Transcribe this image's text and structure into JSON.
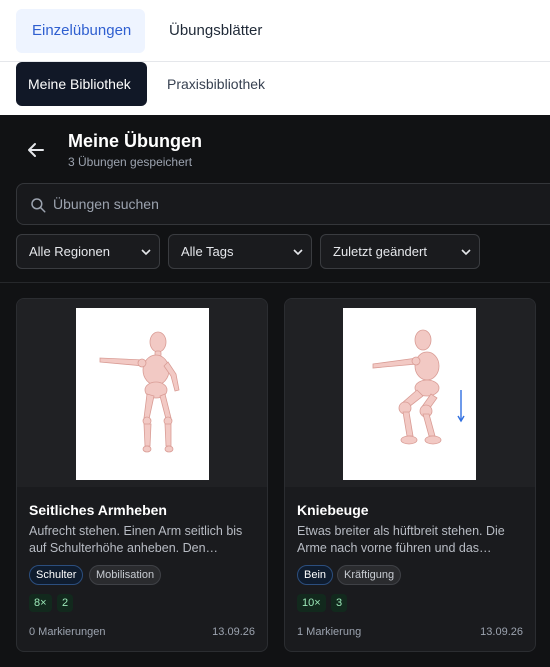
{
  "top_tabs": {
    "active": "Einzelübungen",
    "inactive": "Übungsblätter"
  },
  "sub_tabs": {
    "active": "Meine Bibliothek",
    "inactive": "Praxisbibliothek"
  },
  "header": {
    "title": "Meine Übungen",
    "subtitle": "3 Übungen gespeichert"
  },
  "search": {
    "placeholder": "Übungen suchen",
    "value": ""
  },
  "filters": {
    "region": "Alle Regionen",
    "tags": "Alle Tags",
    "sort": "Zuletzt geändert"
  },
  "cards": [
    {
      "title": "Seitliches Armheben",
      "description": "Aufrecht stehen. Einen Arm seitlich bis auf Schulterhöhe anheben. Den…",
      "tag_primary": "Schulter",
      "tag_secondary": "Mobilisation",
      "reps": "8×",
      "sets": "2",
      "markings": "0 Markierungen",
      "date": "13.09.26"
    },
    {
      "title": "Kniebeuge",
      "description": "Etwas breiter als hüftbreit stehen. Die Arme nach vorne führen und das…",
      "tag_primary": "Bein",
      "tag_secondary": "Kräftigung",
      "reps": "10×",
      "sets": "3",
      "markings": "1 Markierung",
      "date": "13.09.26"
    }
  ],
  "colors": {
    "accent": "#2f5fd0",
    "dark_bg": "#111214",
    "card_bg": "#1a1b1e",
    "tag_blue_border": "#2b4e7e",
    "stat_green": "#9be8b8"
  }
}
